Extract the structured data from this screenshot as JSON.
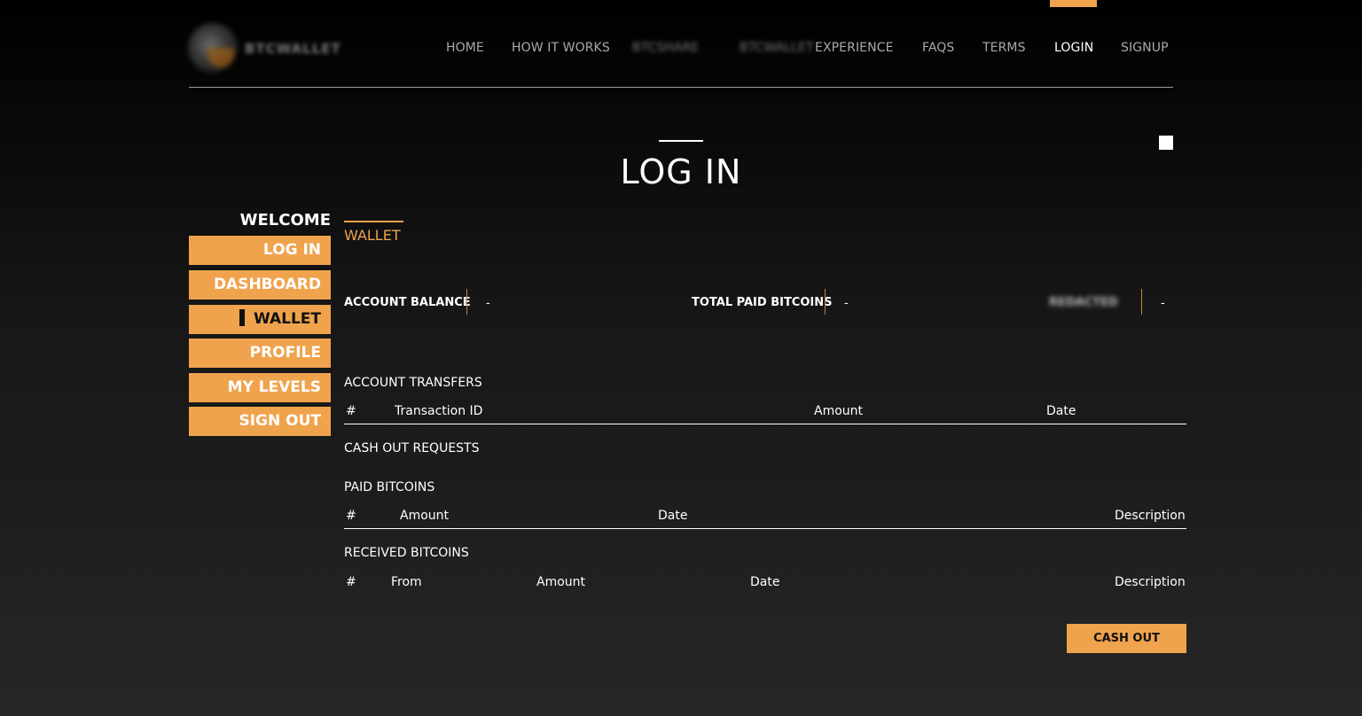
{
  "header": {
    "logo_text": "BTCWALLET",
    "nav": [
      {
        "label": "HOME",
        "active": false
      },
      {
        "label": "HOW IT WORKS",
        "active": false
      },
      {
        "label": "BTCSHARE",
        "active": false
      },
      {
        "label": "BTCWALLET",
        "active": false
      },
      {
        "label": "EXPERIENCE",
        "active": false
      },
      {
        "label": "FAQS",
        "active": false
      },
      {
        "label": "TERMS",
        "active": false
      },
      {
        "label": "LOGIN",
        "active": true
      },
      {
        "label": "SIGNUP",
        "active": false
      }
    ]
  },
  "page": {
    "title": "LOG IN"
  },
  "sidebar": {
    "welcome": "WELCOME",
    "items": [
      {
        "label": "LOG IN"
      },
      {
        "label": "DASHBOARD"
      },
      {
        "label": "WALLET",
        "current": true
      },
      {
        "label": "PROFILE"
      },
      {
        "label": "MY LEVELS"
      },
      {
        "label": "SIGN OUT"
      }
    ]
  },
  "wallet": {
    "title": "WALLET",
    "stats": [
      {
        "label": "ACCOUNT BALANCE",
        "value": "-"
      },
      {
        "label": "TOTAL PAID BITCOINS",
        "value": "-"
      },
      {
        "label": "REDACTED",
        "value": "-"
      }
    ],
    "account_transfers": {
      "title": "ACCOUNT TRANSFERS",
      "columns": [
        "#",
        "Transaction ID",
        "Amount",
        "Date"
      ]
    },
    "cash_out_requests": {
      "title": "CASH OUT REQUESTS"
    },
    "paid_bitcoins": {
      "title": "PAID BITCOINS",
      "columns": [
        "#",
        "Amount",
        "Date",
        "Description"
      ]
    },
    "received_bitcoins": {
      "title": "RECEIVED BITCOINS",
      "columns": [
        "#",
        "From",
        "Amount",
        "Date",
        "Description"
      ]
    },
    "cash_out_button": "CASH OUT"
  },
  "colors": {
    "accent": "#f0a34d",
    "text": "#ffffff",
    "nav_text": "#a9a9a9"
  }
}
